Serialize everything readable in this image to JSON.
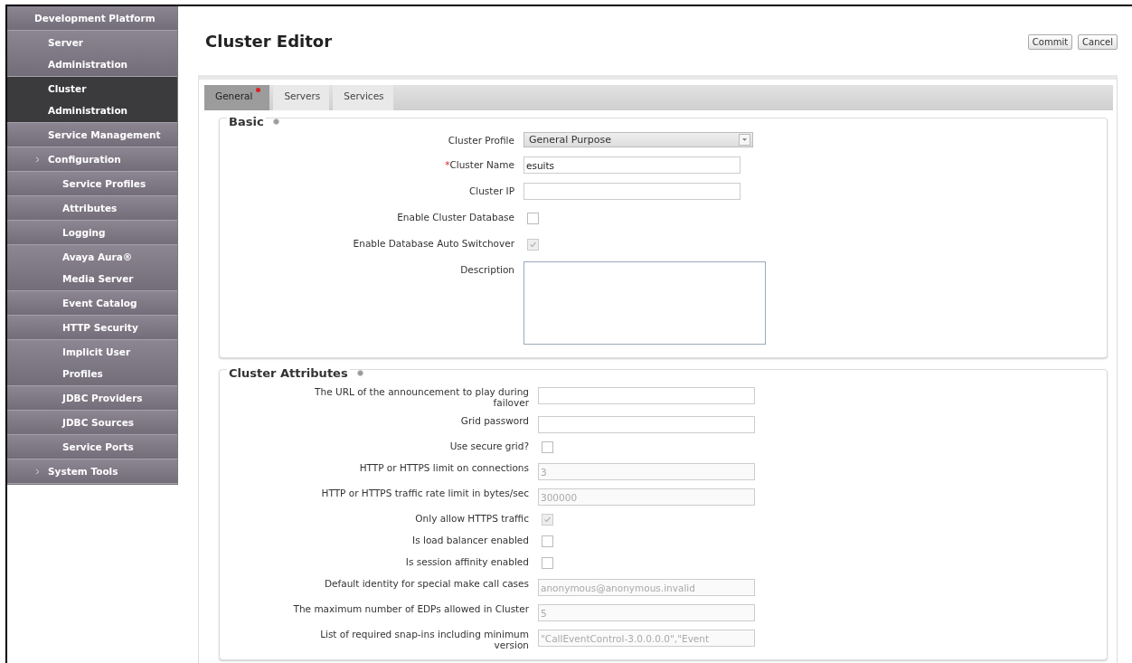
{
  "sidebar": {
    "items": [
      {
        "label": "Development Platform",
        "selected": false,
        "children": [
          {
            "label": "Server Administration",
            "selected": false
          },
          {
            "label": "Cluster Administration",
            "selected": true
          },
          {
            "label": "Service Management",
            "selected": false
          },
          {
            "label": "Configuration",
            "selected": false,
            "arrow": true,
            "children": [
              {
                "label": "Service Profiles",
                "selected": false
              },
              {
                "label": "Attributes",
                "selected": false
              },
              {
                "label": "Logging",
                "selected": false
              },
              {
                "label": "Avaya Aura® Media Server",
                "selected": false
              },
              {
                "label": "Event Catalog",
                "selected": false
              },
              {
                "label": "HTTP Security",
                "selected": false
              },
              {
                "label": "Implicit User Profiles",
                "selected": false
              },
              {
                "label": "JDBC Providers",
                "selected": false
              },
              {
                "label": "JDBC Sources",
                "selected": false
              },
              {
                "label": "Service Ports",
                "selected": false
              }
            ]
          },
          {
            "label": "System Tools",
            "selected": false,
            "arrow": true
          }
        ]
      }
    ]
  },
  "page": {
    "title": "Cluster Editor",
    "buttons": [
      "Commit",
      "Cancel"
    ]
  },
  "tabs": [
    {
      "label": "General",
      "selected": true,
      "error_marker": true
    },
    {
      "label": "Servers",
      "selected": false,
      "error_marker": false
    },
    {
      "label": "Services",
      "selected": false,
      "error_marker": false
    }
  ],
  "sections": [
    {
      "title": "Basic",
      "fields": [
        {
          "kind": "select",
          "label": "Cluster Profile",
          "value": "General Purpose"
        },
        {
          "kind": "text",
          "label": "Cluster Name",
          "required_mark": "*",
          "value": "esuits"
        },
        {
          "kind": "text",
          "label": "Cluster IP"
        },
        {
          "kind": "checkbox",
          "label": "Enable Cluster Database",
          "checked": false,
          "disabled": false
        },
        {
          "kind": "checkbox",
          "label": "Enable Database Auto Switchover",
          "checked": true,
          "disabled": true
        },
        {
          "kind": "textarea",
          "label": "Description"
        }
      ]
    },
    {
      "title": "Cluster Attributes",
      "fields": [
        {
          "kind": "text",
          "label": "The URL of the announcement to play during failover"
        },
        {
          "kind": "text",
          "label": "Grid password"
        },
        {
          "kind": "checkbox",
          "label": "Use secure grid?",
          "checked": false,
          "disabled": false
        },
        {
          "kind": "text",
          "label": "HTTP or HTTPS limit on connections",
          "value": "3",
          "disabled": true
        },
        {
          "kind": "text",
          "label": "HTTP or HTTPS traffic rate limit in bytes/sec",
          "value": "300000",
          "disabled": true
        },
        {
          "kind": "checkbox",
          "label": "Only allow HTTPS traffic",
          "checked": true,
          "disabled": true
        },
        {
          "kind": "checkbox",
          "label": "Is load balancer enabled",
          "checked": false,
          "disabled": false
        },
        {
          "kind": "checkbox",
          "label": "Is session affinity enabled",
          "checked": false,
          "disabled": false
        },
        {
          "kind": "text",
          "label": "Default identity for special make call cases",
          "value": "anonymous@anonymous.invalid",
          "disabled": true
        },
        {
          "kind": "text",
          "label": "The maximum number of EDPs allowed in Cluster",
          "value": "5",
          "disabled": true
        },
        {
          "kind": "text",
          "label": "List of required snap-ins including minimum version",
          "value": "\"CallEventControl-3.0.0.0.0\",\"Event",
          "disabled": true
        }
      ]
    }
  ]
}
